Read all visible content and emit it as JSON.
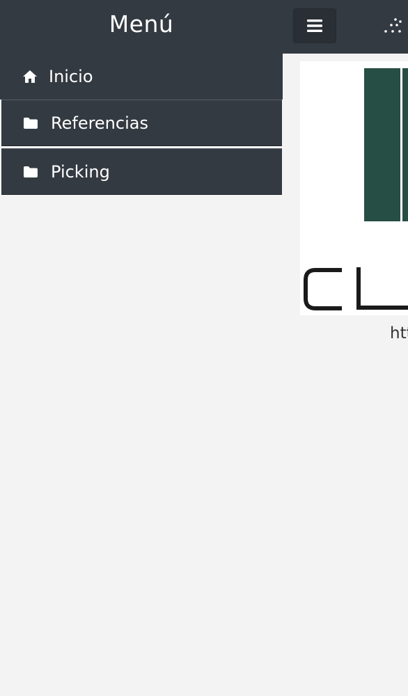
{
  "header": {
    "title": "Menú",
    "menu_toggle_icon": "hamburger-icon",
    "more_icon": "dots-icon"
  },
  "menu": {
    "items": [
      {
        "label": "Inicio",
        "icon": "home-icon"
      },
      {
        "label": "Referencias",
        "icon": "folder-icon"
      },
      {
        "label": "Picking",
        "icon": "folder-icon"
      }
    ]
  },
  "content": {
    "logo_text": "CL",
    "url_text": "htt"
  },
  "colors": {
    "header_bg": "#343a41",
    "menu_bg": "#343a41",
    "page_bg": "#f4f3f4",
    "logo_green": "#264e45",
    "logo_text": "#1a1a1a"
  }
}
